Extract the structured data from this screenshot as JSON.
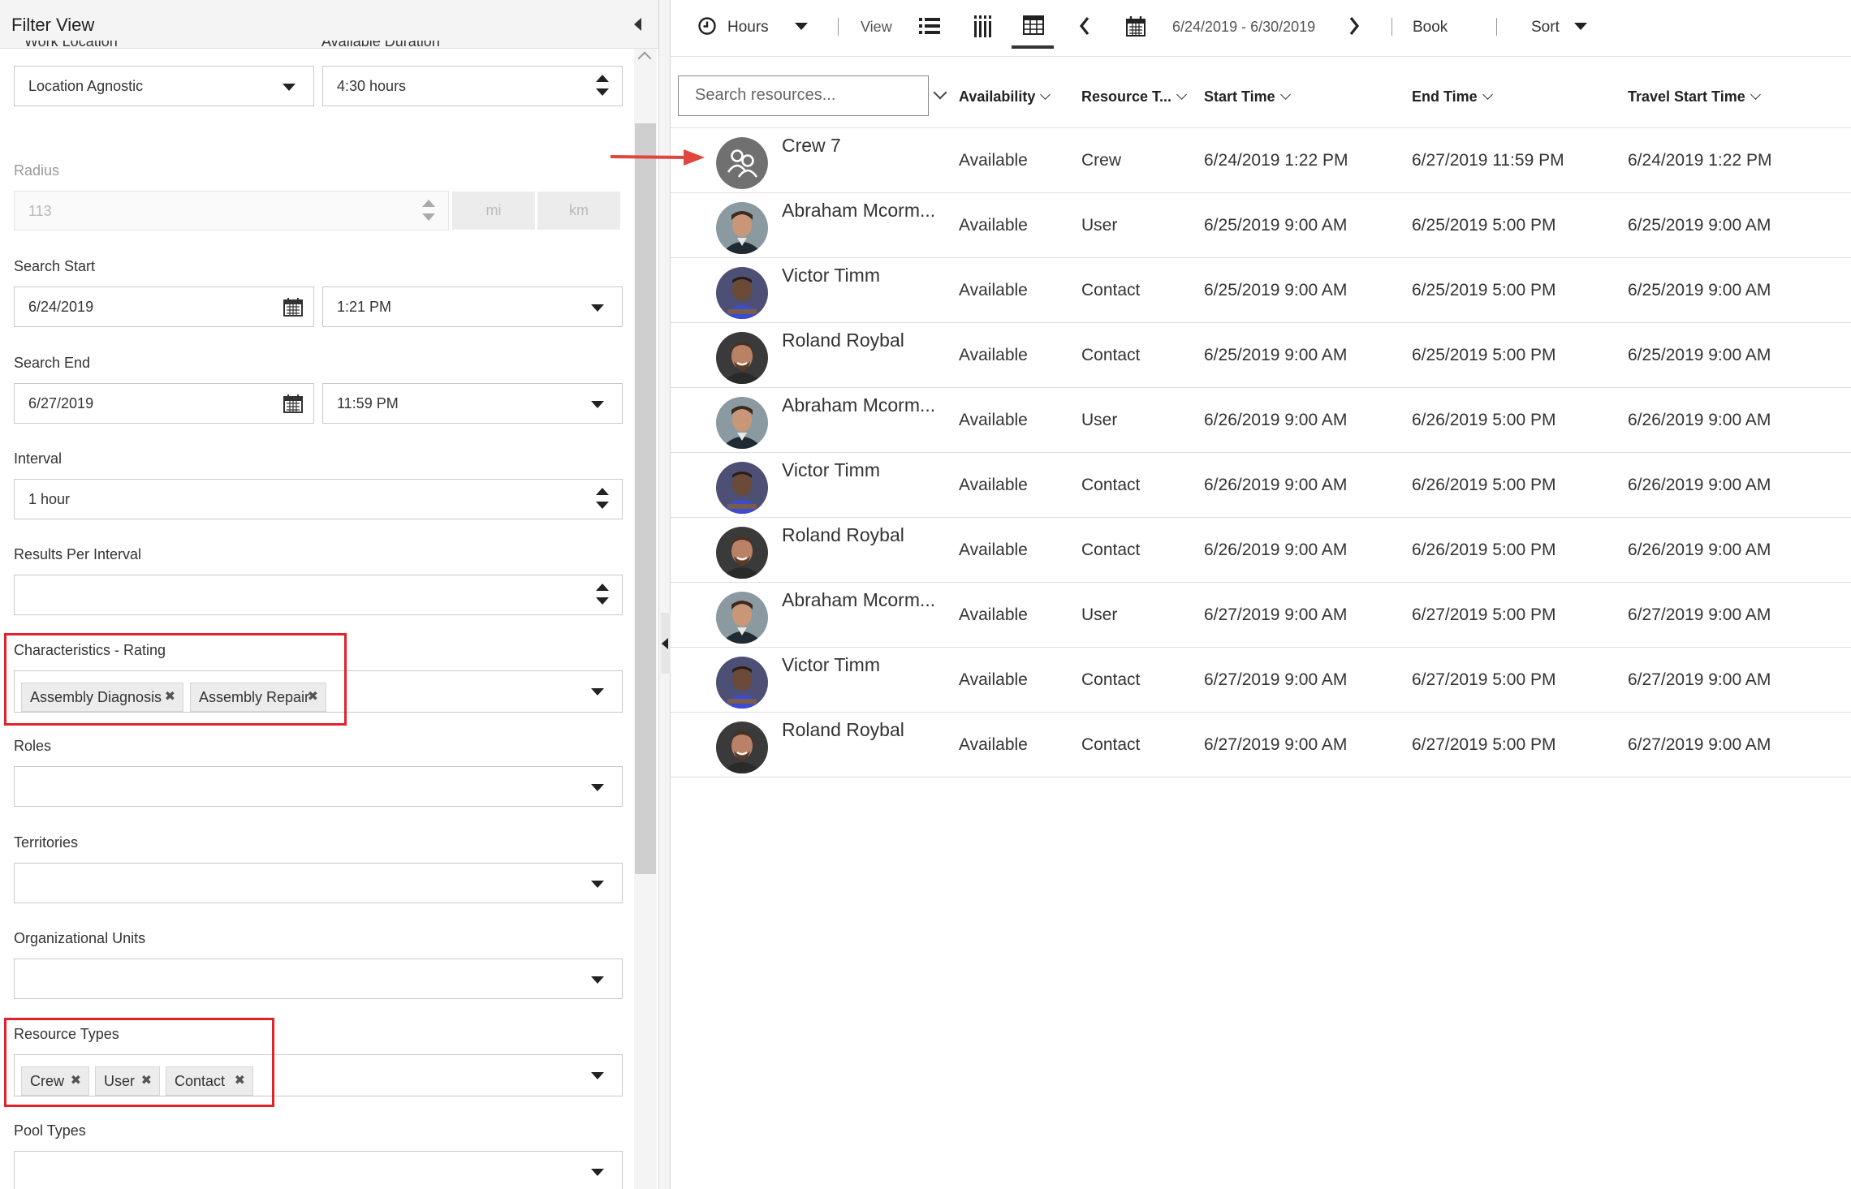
{
  "filter_panel": {
    "title": "Filter View",
    "work_location": {
      "label": "Work Location",
      "value": "Location Agnostic"
    },
    "available_duration": {
      "label": "Available Duration",
      "value": "4:30 hours"
    },
    "radius": {
      "label": "Radius",
      "value": "113",
      "unit_mi": "mi",
      "unit_km": "km"
    },
    "search_start": {
      "label": "Search Start",
      "date": "6/24/2019",
      "time": "1:21 PM"
    },
    "search_end": {
      "label": "Search End",
      "date": "6/27/2019",
      "time": "11:59 PM"
    },
    "interval": {
      "label": "Interval",
      "value": "1 hour"
    },
    "results_per_interval": {
      "label": "Results Per Interval",
      "value": ""
    },
    "characteristics": {
      "label": "Characteristics - Rating",
      "tags": [
        "Assembly Diagnosis",
        "Assembly Repair"
      ]
    },
    "roles": {
      "label": "Roles"
    },
    "territories": {
      "label": "Territories"
    },
    "org_units": {
      "label": "Organizational Units"
    },
    "resource_types": {
      "label": "Resource Types",
      "tags": [
        "Crew",
        "User",
        "Contact"
      ]
    },
    "pool_types": {
      "label": "Pool Types"
    }
  },
  "toolbar": {
    "hours_label": "Hours",
    "view_label": "View",
    "date_range": "6/24/2019 - 6/30/2019",
    "book_label": "Book",
    "sort_label": "Sort"
  },
  "search": {
    "placeholder": "Search resources..."
  },
  "columns": {
    "availability": "Availability",
    "resource_type": "Resource T...",
    "start_time": "Start Time",
    "end_time": "End Time",
    "travel_start_time": "Travel Start Time"
  },
  "rows": [
    {
      "name": "Crew 7",
      "availability": "Available",
      "type": "Crew",
      "start": "6/24/2019 1:22 PM",
      "end": "6/27/2019 11:59 PM",
      "travel": "6/24/2019 1:22 PM",
      "avatar": "crew-icon"
    },
    {
      "name": "Abraham Mcorm...",
      "availability": "Available",
      "type": "User",
      "start": "6/25/2019 9:00 AM",
      "end": "6/25/2019 5:00 PM",
      "travel": "6/25/2019 9:00 AM",
      "avatar": "abraham"
    },
    {
      "name": "Victor Timm",
      "availability": "Available",
      "type": "Contact",
      "start": "6/25/2019 9:00 AM",
      "end": "6/25/2019 5:00 PM",
      "travel": "6/25/2019 9:00 AM",
      "avatar": "victor"
    },
    {
      "name": "Roland Roybal",
      "availability": "Available",
      "type": "Contact",
      "start": "6/25/2019 9:00 AM",
      "end": "6/25/2019 5:00 PM",
      "travel": "6/25/2019 9:00 AM",
      "avatar": "roland"
    },
    {
      "name": "Abraham Mcorm...",
      "availability": "Available",
      "type": "User",
      "start": "6/26/2019 9:00 AM",
      "end": "6/26/2019 5:00 PM",
      "travel": "6/26/2019 9:00 AM",
      "avatar": "abraham"
    },
    {
      "name": "Victor Timm",
      "availability": "Available",
      "type": "Contact",
      "start": "6/26/2019 9:00 AM",
      "end": "6/26/2019 5:00 PM",
      "travel": "6/26/2019 9:00 AM",
      "avatar": "victor"
    },
    {
      "name": "Roland Roybal",
      "availability": "Available",
      "type": "Contact",
      "start": "6/26/2019 9:00 AM",
      "end": "6/26/2019 5:00 PM",
      "travel": "6/26/2019 9:00 AM",
      "avatar": "roland"
    },
    {
      "name": "Abraham Mcorm...",
      "availability": "Available",
      "type": "User",
      "start": "6/27/2019 9:00 AM",
      "end": "6/27/2019 5:00 PM",
      "travel": "6/27/2019 9:00 AM",
      "avatar": "abraham"
    },
    {
      "name": "Victor Timm",
      "availability": "Available",
      "type": "Contact",
      "start": "6/27/2019 9:00 AM",
      "end": "6/27/2019 5:00 PM",
      "travel": "6/27/2019 9:00 AM",
      "avatar": "victor"
    },
    {
      "name": "Roland Roybal",
      "availability": "Available",
      "type": "Contact",
      "start": "6/27/2019 9:00 AM",
      "end": "6/27/2019 5:00 PM",
      "travel": "6/27/2019 9:00 AM",
      "avatar": "roland"
    }
  ],
  "colors": {
    "highlight": "#e0232b",
    "arrow": "#e0463c"
  }
}
